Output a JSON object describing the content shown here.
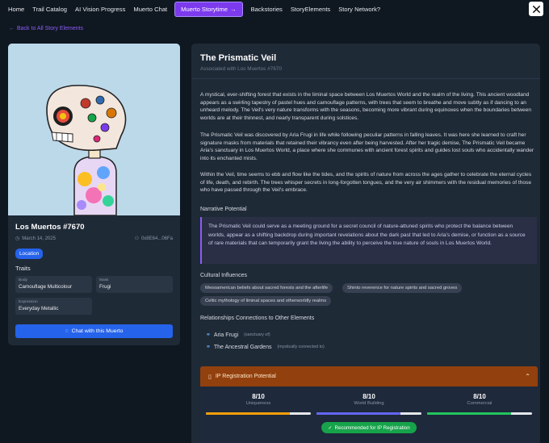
{
  "nav": {
    "items": [
      "Home",
      "Trail Catalog",
      "AI Vision Progress",
      "Muerto Chat"
    ],
    "active": "Muerto Storytime",
    "items_right": [
      "Backstories",
      "StoryElements",
      "Story Network?"
    ]
  },
  "back_label": "Back to All Story Elements",
  "card": {
    "title": "Los Muertos #7670",
    "date": "March 14, 2025",
    "address": "0x8E64...06Fa",
    "badge": "Location",
    "traits_heading": "Traits",
    "traits": [
      {
        "key": "Body",
        "value": "Camouflage Multicolour"
      },
      {
        "key": "Mask",
        "value": "Frugi"
      },
      {
        "key": "Expression",
        "value": "Everyday Metallic"
      }
    ],
    "chat_label": "Chat with this Muerto"
  },
  "main": {
    "title": "The Prismatic Veil",
    "subtitle": "Associated with Los Muertos #7670",
    "paragraphs": [
      "A mystical, ever-shifting forest that exists in the liminal space between Los Muertos World and the realm of the living. This ancient woodland appears as a swirling tapestry of pastel hues and camouflage patterns, with trees that seem to breathe and move subtly as if dancing to an unheard melody. The Veil's very nature transforms with the seasons, becoming more vibrant during equinoxes when the boundaries between worlds are at their thinnest, and nearly transparent during solstices.",
      "The Prismatic Veil was discovered by Aria Frugi in life while following peculiar patterns in falling leaves. It was here she learned to craft her signature masks from materials that retained their vibrancy even after being harvested. After her tragic demise, The Prismatic Veil became Aria's sanctuary in Los Muertos World, a place where she communes with ancient forest spirits and guides lost souls who accidentally wander into its enchanted mists.",
      "Within the Veil, time seems to ebb and flow like the tides, and the spirits of nature from across the ages gather to celebrate the eternal cycles of life, death, and rebirth. The trees whisper secrets in long-forgotten tongues, and the very air shimmers with the residual memories of those who have passed through the Veil's embrace."
    ],
    "narrative_heading": "Narrative Potential",
    "narrative": "The Prismatic Veil could serve as a meeting ground for a secret council of nature-attuned spirits who protect the balance between worlds, appear as a shifting backdrop during important revelations about the dark past that led to Aria's demise, or function as a source of rare materials that can temporarily grant the living the ability to perceive the true nature of souls in Los Muertos World.",
    "cultural_heading": "Cultural Influences",
    "cultural": [
      "Mesoamerican beliefs about sacred forests and the afterlife",
      "Shinto reverence for nature spirits and sacred groves",
      "Celtic mythology of liminal spaces and otherworldly realms"
    ],
    "relationships_heading": "Relationships Connections to Other Elements",
    "relationships": [
      {
        "name": "Aria Frugi",
        "type": "(sanctuary of)"
      },
      {
        "name": "The Ancestral Gardens",
        "type": "(mystically connected to)"
      }
    ],
    "ip": {
      "heading": "IP Registration Potential",
      "metrics": [
        {
          "value": "8/10",
          "label": "Uniqueness",
          "level": 0.8,
          "color": "#f59e0b"
        },
        {
          "value": "8/10",
          "label": "World Building",
          "level": 0.8,
          "color": "#6366f1"
        },
        {
          "value": "8/10",
          "label": "Commercial",
          "level": 0.8,
          "color": "#22c55e"
        }
      ],
      "recommendation": "Recommended for IP Registration"
    }
  }
}
